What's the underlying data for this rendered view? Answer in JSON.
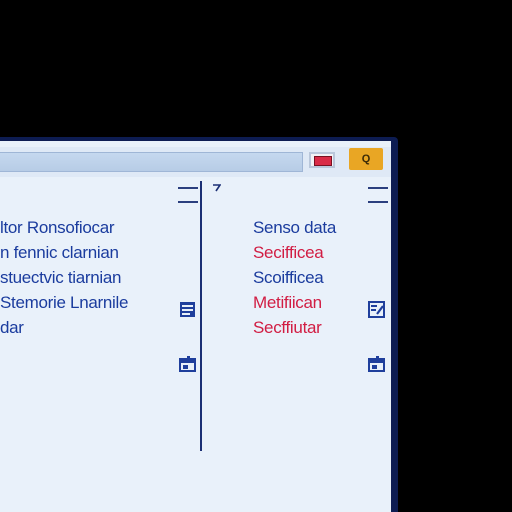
{
  "window": {
    "title_button_label": "Q"
  },
  "left_list": {
    "items": [
      {
        "label": "ltor Ronsofiocar",
        "color": "#1b3c9e"
      },
      {
        "label": "n fennic clarnian",
        "color": "#1b3c9e"
      },
      {
        "label": "stuectvic tiarnian",
        "color": "#1b3c9e"
      },
      {
        "label": "Stemorie Lnarnile",
        "color": "#1b3c9e"
      },
      {
        "label": "dar",
        "color": "#1b3c9e"
      }
    ]
  },
  "right_list": {
    "items": [
      {
        "label": "Senso data",
        "color": "#1b3c9e"
      },
      {
        "label": "Secifficea",
        "color": "#d11d43"
      },
      {
        "label": "Scoifficea",
        "color": "#1b3c9e"
      },
      {
        "label": "Metifiican",
        "color": "#d11d43"
      },
      {
        "label": "Secffiutar",
        "color": "#d11d43"
      }
    ]
  },
  "icons": {
    "left_list_icon": "list-icon",
    "left_edit_icon": "window-icon",
    "right_list_icon": "edit-icon",
    "right_window_icon": "window-icon",
    "titlebar_red": "red-swatch-icon",
    "pane_marker": "caret-icon"
  }
}
